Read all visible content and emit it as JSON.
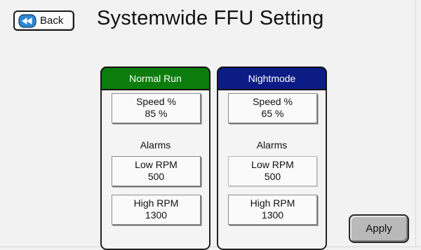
{
  "header": {
    "back_label": "Back",
    "title": "Systemwide FFU Setting"
  },
  "icons": {
    "back": "rewind-left-icon"
  },
  "colors": {
    "normal_run_header": "#0c7d0c",
    "nightmode_header": "#0c1c86"
  },
  "modes": {
    "normal": {
      "title": "Normal Run",
      "speed": {
        "label": "Speed %",
        "value": "85 %"
      },
      "alarms_label": "Alarms",
      "low_rpm": {
        "label": "Low RPM",
        "value": "500"
      },
      "high_rpm": {
        "label": "High RPM",
        "value": "1300"
      }
    },
    "night": {
      "title": "Nightmode",
      "speed": {
        "label": "Speed %",
        "value": "65 %"
      },
      "alarms_label": "Alarms",
      "low_rpm": {
        "label": "Low RPM",
        "value": "500"
      },
      "high_rpm": {
        "label": "High RPM",
        "value": "1300"
      }
    }
  },
  "actions": {
    "apply_label": "Apply"
  }
}
